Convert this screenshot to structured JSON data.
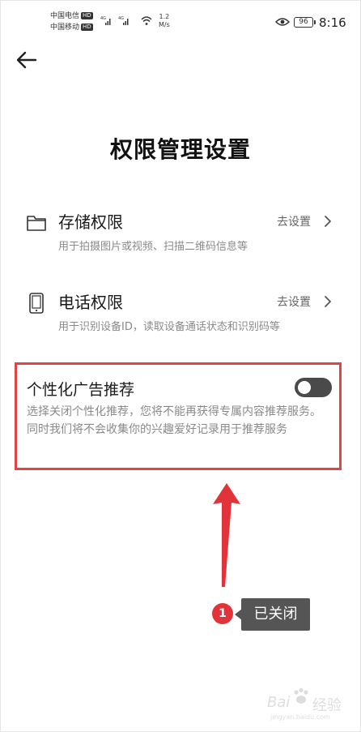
{
  "status_bar": {
    "carrier1": "中国电信",
    "carrier2": "中国移动",
    "hd_label": "HD",
    "network_label": "4G",
    "speed_value": "1.2",
    "speed_unit": "M/s",
    "battery": "96",
    "time": "8:16"
  },
  "page": {
    "title": "权限管理设置"
  },
  "permissions": [
    {
      "icon": "folder-icon",
      "title": "存储权限",
      "action": "去设置",
      "desc": "用于拍摄图片或视频、扫描二维码信息等"
    },
    {
      "icon": "phone-icon",
      "title": "电话权限",
      "action": "去设置",
      "desc": "用于识别设备ID，读取设备通话状态和识别码等"
    }
  ],
  "ad_setting": {
    "title": "个性化广告推荐",
    "desc": "选择关闭个性化推荐，您将不能再获得专属内容推荐服务。同时我们将不会收集你的兴趣爱好记录用于推荐服务",
    "enabled": false
  },
  "annotation": {
    "step": "1",
    "label": "已关闭",
    "accent": "#e2333a"
  },
  "watermark": {
    "text_left": "Bai",
    "text_right": "经验",
    "url": "jingyan.baidu.com"
  },
  "colors": {
    "highlight": "#e34343",
    "toggle_off": "#4a4a4a",
    "tooltip": "#555555"
  }
}
